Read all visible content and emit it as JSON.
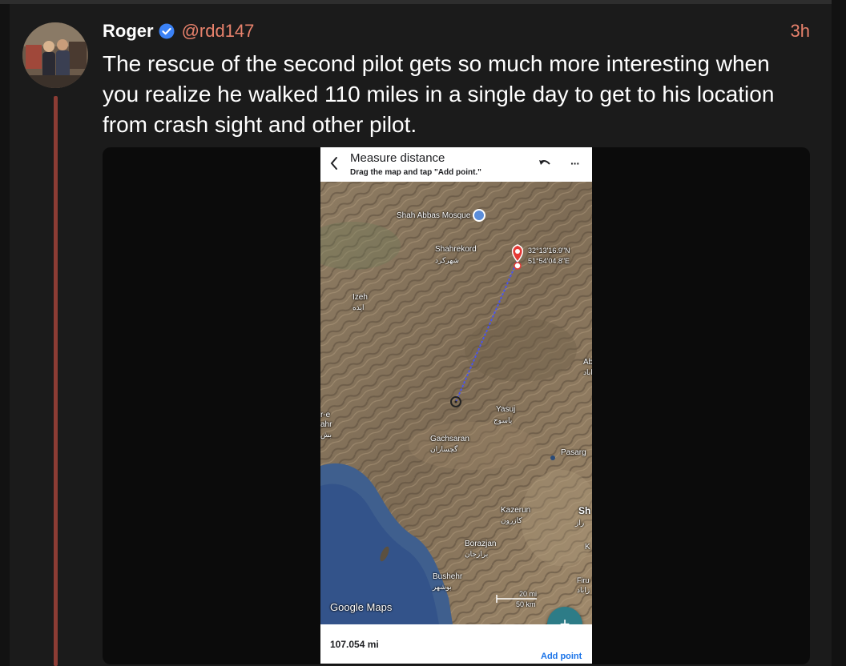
{
  "post": {
    "author_name": "Roger",
    "handle": "@rdd147",
    "time": "3h",
    "text": "The rescue of the second pilot gets so much more interesting when you realize he walked 110 miles in a single day to get to his location from crash sight and other pilot.",
    "colors": {
      "accent": "#e8826c",
      "thread_line": "#8c3c34",
      "verified": "#3b82f6"
    }
  },
  "screenshot": {
    "title": "Measure distance",
    "subtitle": "Drag the map and tap \"Add point.\"",
    "icons": {
      "back": "chevron-left-icon",
      "undo": "undo-icon",
      "more": "more-icon",
      "add": "plus-icon"
    },
    "more_glyph": "···",
    "fab_glyph": "+",
    "map": {
      "poi": "Shah Abbas Mosque",
      "labels": {
        "shahrekord": "Shahrekord",
        "shahrekord_fa": "شهرکرد",
        "izeh": "Izeh",
        "izeh_fa": "ایذه",
        "yasuj": "Yasuj",
        "yasuj_fa": "یاسوج",
        "gachsaran": "Gachsaran",
        "gachsaran_fa": "گچساران",
        "pasargad": "Pasarg",
        "kazerun": "Kazerun",
        "kazerun_fa": "کازرون",
        "borazjan": "Borazjan",
        "borazjan_fa": "برازجان",
        "bushehr": "Bushehr",
        "bushehr_fa": "بوشهر",
        "edge_left_1": "r-e",
        "edge_left_2": "ahr",
        "edge_left_3": "بش",
        "edge_right_1": "Ab",
        "edge_right_2": "اباد",
        "edge_right_3": "Sh",
        "edge_right_4": "راز",
        "edge_right_5": "K",
        "edge_right_6": "Firu",
        "edge_right_7": "زاباد"
      },
      "coord_lat": "32°13'16.9\"N",
      "coord_lon": "51°54'04.8\"E",
      "scale_mi": "20 mi",
      "scale_km": "50 km",
      "attribution": "Google Maps"
    },
    "distance": "107.054 mi",
    "add_point": "Add point"
  }
}
